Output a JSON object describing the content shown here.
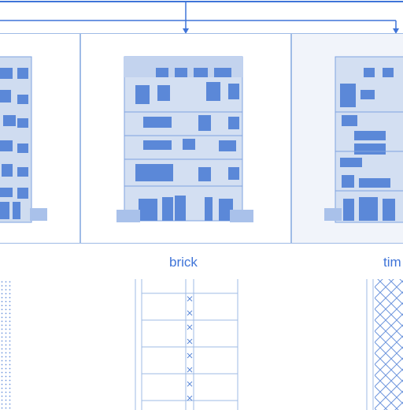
{
  "labels": {
    "brick": "brick",
    "timber": "tim"
  },
  "colors": {
    "line": "#3f74d8",
    "panel_border": "#9fbbe6",
    "panel_fill": "#f1f4fa",
    "facade": "#cfdcf0",
    "window": "#5b88d8"
  }
}
